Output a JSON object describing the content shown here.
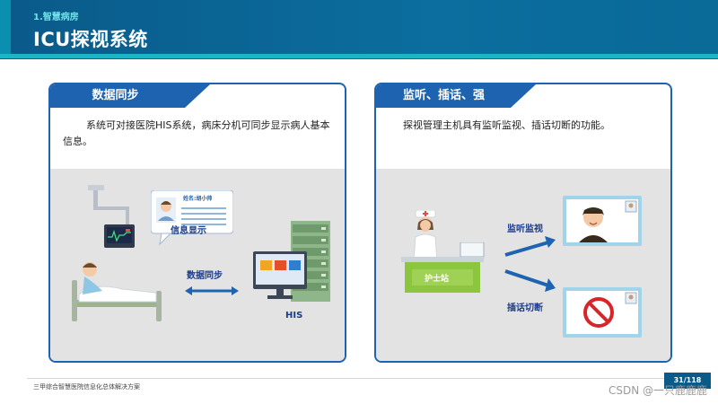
{
  "header": {
    "subtitle": "1.智慧病房",
    "title": "ICU探视系统"
  },
  "left_panel": {
    "tab_label": "数据同步",
    "description": "系统可对接医院HIS系统，病床分机可同步显示病人基本信息。",
    "card_name": "姓名:胡小帅",
    "card_label": "信息显示",
    "sync_label": "数据同步",
    "his_label": "HIS"
  },
  "right_panel": {
    "tab_label": "监听、插话、强切",
    "description": "探视管理主机具有监听监视、插话切断的功能。",
    "station_label": "护士站",
    "monitor_label": "监听监视",
    "cutoff_label": "插话切断"
  },
  "footer": {
    "doc_title": "三甲综合智慧医院信息化总体解决方案",
    "page": "31/118",
    "watermark": "CSDN @一只鹿鹿鹿"
  },
  "colors": {
    "header": "#0a5a8a",
    "accent": "#1bb5c4",
    "panel_border": "#1e63b0",
    "stage": "#e3e3e3"
  }
}
